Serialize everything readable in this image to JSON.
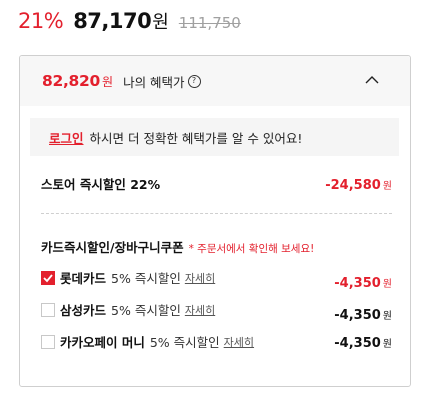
{
  "price": {
    "discount_rate": "21%",
    "sale_price": "87,170",
    "sale_unit": "원",
    "original_price": "111,750"
  },
  "benefit": {
    "price": "82,820",
    "unit": "원",
    "label": "나의 혜택가",
    "info_glyph": "?",
    "collapse_icon": "chevron-up-icon"
  },
  "login_banner": {
    "link": "로그인",
    "text": "하시면 더 정확한 혜택가를 알 수 있어요!"
  },
  "store_discount": {
    "label": "스토어 즉시할인 22%",
    "amount": "-24,580",
    "unit": "원"
  },
  "card_section": {
    "title": "카드즉시할인/장바구니쿠폰",
    "note": "* 주문서에서 확인해 보세요!"
  },
  "card_discounts": [
    {
      "name": "롯데카드",
      "desc": "5% 즉시할인",
      "detail": "자세히",
      "amount": "-4,350",
      "unit": "원",
      "checked": true
    },
    {
      "name": "삼성카드",
      "desc": "5% 즉시할인",
      "detail": "자세히",
      "amount": "-4,350",
      "unit": "원",
      "checked": false
    },
    {
      "name": "카카오페이 머니",
      "desc": "5% 즉시할인",
      "detail": "자세히",
      "amount": "-4,350",
      "unit": "원",
      "checked": false
    }
  ],
  "colors": {
    "accent": "#e3202d",
    "header_bg": "#f7f7f7",
    "banner_bg": "#f5f5f5",
    "border": "#cfcfcf"
  }
}
